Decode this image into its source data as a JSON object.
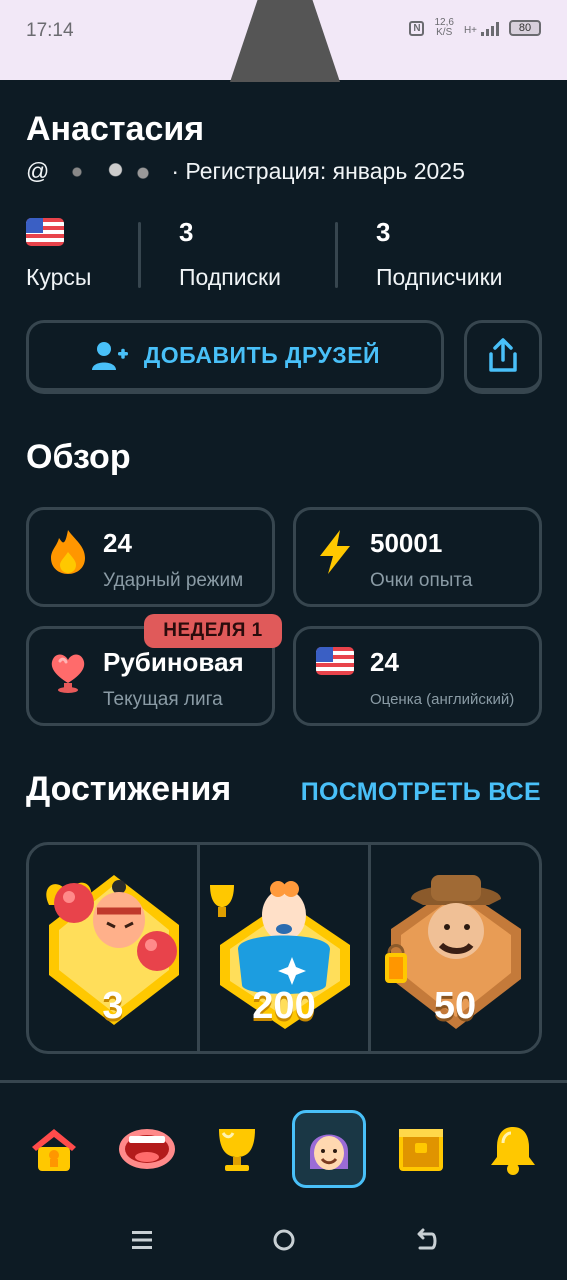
{
  "status_bar": {
    "time": "17:14",
    "nfc": "N",
    "speed_value": "12,6",
    "speed_unit": "K/S",
    "network": "H+",
    "battery": "80"
  },
  "profile": {
    "name": "Анастасия",
    "handle_prefix": "@",
    "registration": "· Регистрация: январь 2025"
  },
  "stats": [
    {
      "value": "",
      "label": "Курсы",
      "icon": "us-flag-icon"
    },
    {
      "value": "3",
      "label": "Подписки"
    },
    {
      "value": "3",
      "label": "Подписчики"
    }
  ],
  "actions": {
    "add_friends": "ДОБАВИТЬ ДРУЗЕЙ",
    "share_icon": "share-icon"
  },
  "overview": {
    "title": "Обзор",
    "cards": [
      {
        "value": "24",
        "label": "Ударный режим",
        "icon": "flame-icon"
      },
      {
        "value": "50001",
        "label": "Очки опыта",
        "icon": "lightning-icon"
      },
      {
        "value": "Рубиновая",
        "label": "Текущая лига",
        "icon": "ruby-league-icon",
        "badge": "НЕДЕЛЯ 1"
      },
      {
        "value": "24",
        "label": "Оценка (английский)",
        "icon": "us-flag-icon"
      }
    ]
  },
  "achievements": {
    "title": "Достижения",
    "see_all": "ПОСМОТРЕТЬ ВСЕ",
    "items": [
      {
        "value": "3",
        "icon": "boxer-badge-icon"
      },
      {
        "value": "200",
        "icon": "trophy-badge-icon"
      },
      {
        "value": "50",
        "icon": "explorer-badge-icon"
      }
    ]
  },
  "bottom_nav": [
    "home-icon",
    "mouth-icon",
    "trophy-icon",
    "profile-avatar-icon",
    "chest-icon",
    "bell-icon"
  ],
  "colors": {
    "background": "#0d1b24",
    "accent": "#49c0f8",
    "border": "#37464f",
    "muted": "#8a9ba5",
    "badge": "#e05a5a"
  }
}
